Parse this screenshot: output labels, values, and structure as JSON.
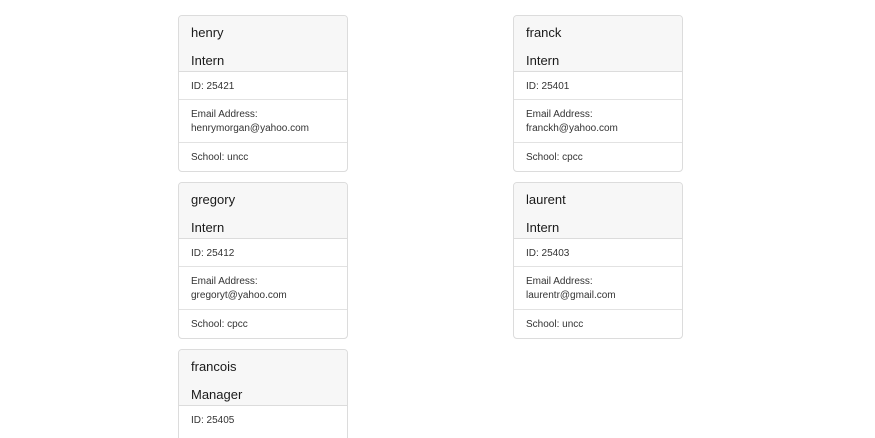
{
  "labels": {
    "id_prefix": "ID: ",
    "email_label": "Email Address:",
    "school_prefix": "School: "
  },
  "cards": [
    {
      "name": "henry",
      "role": "Intern",
      "id": "ID: 25421",
      "email_label": "Email Address:",
      "email": "henrymorgan@yahoo.com",
      "extra": "School: uncc"
    },
    {
      "name": "franck",
      "role": "Intern",
      "id": "ID: 25401",
      "email_label": "Email Address:",
      "email": "franckh@yahoo.com",
      "extra": "School: cpcc"
    },
    {
      "name": "gregory",
      "role": "Intern",
      "id": "ID: 25412",
      "email_label": "Email Address:",
      "email": "gregoryt@yahoo.com",
      "extra": "School: cpcc"
    },
    {
      "name": "laurent",
      "role": "Intern",
      "id": "ID: 25403",
      "email_label": "Email Address:",
      "email": "laurentr@gmail.com",
      "extra": "School: uncc"
    },
    {
      "name": "francois",
      "role": "Manager",
      "id": "ID: 25405"
    }
  ]
}
